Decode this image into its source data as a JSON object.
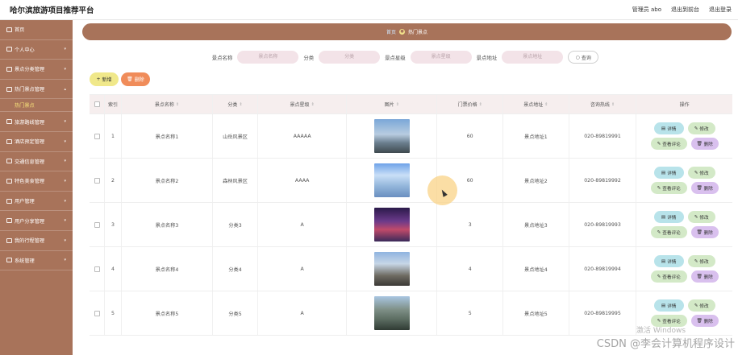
{
  "app": {
    "title": "哈尔滨旅游项目推荐平台"
  },
  "topnav": {
    "user": "管理员 abo",
    "back_front": "退出到前台",
    "logout": "退出登录"
  },
  "sidebar": {
    "items": [
      {
        "label": "首页"
      },
      {
        "label": "个人中心"
      },
      {
        "label": "景点分类管理"
      },
      {
        "label": "热门景点管理"
      },
      {
        "label": "热门景点",
        "sub": true
      },
      {
        "label": "旅游路线管理"
      },
      {
        "label": "酒店预定管理"
      },
      {
        "label": "交通信息管理"
      },
      {
        "label": "特色美食管理"
      },
      {
        "label": "用户管理"
      },
      {
        "label": "用户分享管理"
      },
      {
        "label": "我的行程管理"
      },
      {
        "label": "系统管理"
      }
    ]
  },
  "breadcrumb": {
    "home": "首页",
    "current": "热门景点"
  },
  "search": {
    "name_label": "景点名称",
    "name_placeholder": "景点名称",
    "category_label": "分类",
    "category_placeholder": "分类",
    "level_label": "景点星级",
    "level_placeholder": "景点星级",
    "address_label": "景点地址",
    "address_placeholder": "景点地址",
    "query_button": "查询"
  },
  "actions": {
    "add": "新增",
    "delete": "删除"
  },
  "table": {
    "headers": [
      "索引",
      "景点名称",
      "分类",
      "景点星级",
      "图片",
      "门票价格",
      "景点地址",
      "咨询热线",
      "操作"
    ],
    "rows": [
      {
        "idx": "1",
        "name": "景点名称1",
        "category": "山岳风景区",
        "level": "AAAAA",
        "price": "60",
        "address": "景点地址1",
        "tel": "020-89819991"
      },
      {
        "idx": "2",
        "name": "景点名称2",
        "category": "森林风景区",
        "level": "AAAA",
        "price": "60",
        "address": "景点地址2",
        "tel": "020-89819992"
      },
      {
        "idx": "3",
        "name": "景点名称3",
        "category": "分类3",
        "level": "A",
        "price": "3",
        "address": "景点地址3",
        "tel": "020-89819993"
      },
      {
        "idx": "4",
        "name": "景点名称4",
        "category": "分类4",
        "level": "A",
        "price": "4",
        "address": "景点地址4",
        "tel": "020-89819994"
      },
      {
        "idx": "5",
        "name": "景点名称5",
        "category": "分类5",
        "level": "A",
        "price": "5",
        "address": "景点地址5",
        "tel": "020-89819995"
      }
    ],
    "row_actions": {
      "detail": "详情",
      "edit": "修改",
      "comments": "查看评论",
      "delete": "删除"
    }
  },
  "overlay": {
    "activate": "激活 Windows",
    "watermark": "CSDN @李会计算机程序设计"
  },
  "colors": {
    "sidebar": "#a8735a",
    "accent_yellow": "#f0e88a",
    "accent_orange": "#f08c5a"
  }
}
